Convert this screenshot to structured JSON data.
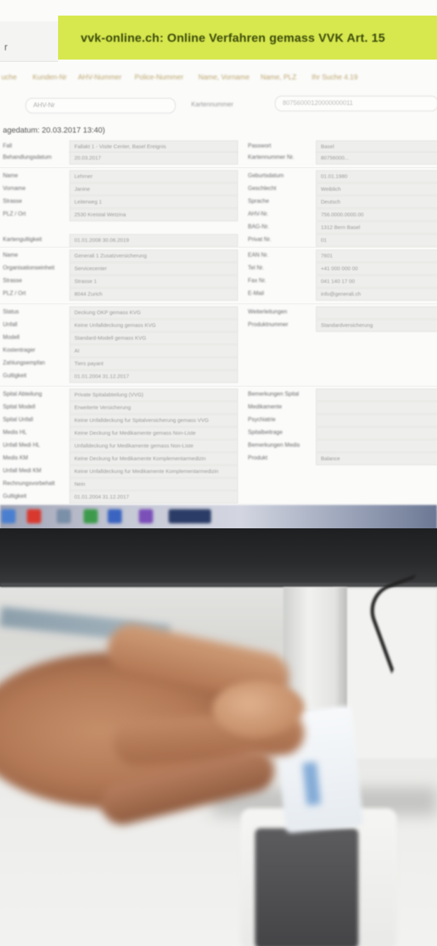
{
  "screen": {
    "banner_title": "vvk-online.ch: Online Verfahren gemass VVK Art. 15",
    "header_left_char": "r",
    "tabs": [
      "uche",
      "Kunden-Nr",
      "AHV-Nummer",
      "Police-Nummer",
      "Name, Vorname",
      "Name, PLZ",
      "Ihr Suche 4.19"
    ],
    "search": {
      "placeholder": "AHV-Nr",
      "label": "Kartennummer",
      "placeholder2": "80756000120000000011"
    },
    "date_row": "agedatum: 20.03.2017 13:40)"
  },
  "form": {
    "sections": [
      {
        "label": "Fall",
        "value": "Fallakt 1 - Visite Center, Basel Ereignis",
        "right_label": "Passwort",
        "right_value": "Basel"
      },
      {
        "label": "Behandlungsdatum",
        "value": "20.03.2017",
        "right_label": "Kartennummer Nr.",
        "right_value": "80756000..."
      },
      {
        "label": "Name",
        "value": "Lehrner",
        "right_label": "Geburtsdatum",
        "right_value": "01.01.1980"
      },
      {
        "label": "Vorname",
        "value": "Janine",
        "right_label": "Geschlecht",
        "right_value": "Weiblich"
      },
      {
        "label": "Strasse",
        "value": "Leiterweg 1",
        "right_label": "Sprache",
        "right_value": "Deutsch"
      },
      {
        "label": "PLZ / Ort",
        "value": "2530 Kreistal Wetzina",
        "right_label": "AHV-Nr.",
        "right_value": "756.0000.0000.00"
      },
      {
        "label": "",
        "value": "",
        "right_label": "BAG-Nr.",
        "right_value": "1312 Bern Basel"
      },
      {
        "label": "Kartengultigkeit",
        "value": "01.01.2008 30.06.2019",
        "right_label": "Privat Nr.",
        "right_value": "01"
      },
      {
        "label": "Name",
        "value": "Generali 1 Zusatzversicherung",
        "right_label": "EAN Nr.",
        "right_value": "7601"
      },
      {
        "label": "Organisationseinheit",
        "value": "Servicecenter",
        "right_label": "Tel Nr.",
        "right_value": "+41 000 000 00"
      },
      {
        "label": "Strasse",
        "value": "Strasse 1",
        "right_label": "Fax Nr.",
        "right_value": "041 140 17 00"
      },
      {
        "label": "PLZ / Ort",
        "value": "8044 Zurich",
        "right_label": "E-Mail",
        "right_value": "info@generali.ch"
      },
      {
        "label": "Status",
        "value": "Deckung OKP gemass KVG",
        "right_label": "Weiterleitungen",
        "right_value": ""
      },
      {
        "label": "Unfall",
        "value": "Keine Unfalldeckung gemass KVG",
        "right_label": "Produktnummer",
        "right_value": "Standardversicherung"
      },
      {
        "label": "Modell",
        "value": "Standard-Modell gemass KVG",
        "right_label": "",
        "right_value": ""
      },
      {
        "label": "Kostentrager",
        "value": "AI",
        "right_label": "",
        "right_value": ""
      },
      {
        "label": "Zahlungsempfan",
        "value": "Tiers payant",
        "right_label": "",
        "right_value": ""
      },
      {
        "label": "Gultigkeit",
        "value": "01.01.2004 31.12.2017",
        "right_label": "",
        "right_value": ""
      },
      {
        "label": "Spital Abteilung",
        "value": "Private Spitalabteilung (VVG)",
        "right_label": "Bemerkungen Spital",
        "right_value": ""
      },
      {
        "label": "Spital Modell",
        "value": "Erweiterte Versicherung",
        "right_label": "Medikamente",
        "right_value": ""
      },
      {
        "label": "Spital Unfall",
        "value": "Keine Unfalldeckung fur Spitalversicherung gemass VVG",
        "right_label": "Psychiatrie",
        "right_value": ""
      },
      {
        "label": "Medis HL",
        "value": "Keine Deckung fur Medikamente gemass Non-Liste",
        "right_label": "Spitalbeitrage",
        "right_value": ""
      },
      {
        "label": "Unfall Medi HL",
        "value": "Unfalldeckung fur Medikamente gemass Non-Liste",
        "right_label": "Bemerkungen Medis",
        "right_value": ""
      },
      {
        "label": "Medis KM",
        "value": "Keine Deckung fur Medikamente Komplementarmedizin",
        "right_label": "Produkt",
        "right_value": "Balance"
      },
      {
        "label": "Unfall Medi KM",
        "value": "Keine Unfalldeckung fur Medikamente Komplementarmedizin",
        "right_label": "",
        "right_value": ""
      },
      {
        "label": "Rechnungsvorbehalt",
        "value": "Nein",
        "right_label": "",
        "right_value": ""
      },
      {
        "label": "Gultigkeit",
        "value": "01.01.2004 31.12.2017",
        "right_label": "",
        "right_value": ""
      }
    ]
  },
  "taskbar": {
    "icons": [
      "windows-start-icon",
      "acrobat-icon",
      "printer-icon",
      "excel-icon",
      "word-icon",
      "onenote-icon",
      "browser-icon"
    ]
  },
  "colors": {
    "banner": "#d7e84e",
    "tab_text": "#bba46a",
    "bezel": "#232426",
    "skin": "#c58f6a"
  }
}
